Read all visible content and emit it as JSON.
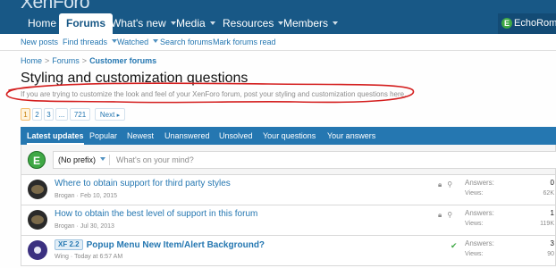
{
  "header": {
    "logo_text": "XenForo"
  },
  "nav": {
    "tabs": [
      {
        "label": "Home",
        "has_menu": false
      },
      {
        "label": "Forums",
        "has_menu": false,
        "active": true
      },
      {
        "label": "What's new",
        "has_menu": true
      },
      {
        "label": "Media",
        "has_menu": true
      },
      {
        "label": "Resources",
        "has_menu": true
      },
      {
        "label": "Members",
        "has_menu": true
      }
    ],
    "user": {
      "avatar_letter": "E",
      "name": "EchoRomeo"
    }
  },
  "subnav": {
    "items": [
      "New posts",
      "Find threads",
      "Watched",
      "Search forums",
      "Mark forums read"
    ]
  },
  "breadcrumb": {
    "items": [
      "Home",
      "Forums",
      "Customer forums"
    ],
    "separator": ">"
  },
  "page": {
    "title": "Styling and customization questions",
    "description": "If you are trying to customize the look and feel of your XenForo forum, post your styling and customization questions here."
  },
  "pagination": {
    "pages": [
      "1",
      "2",
      "3",
      "...",
      "721"
    ],
    "current": "1",
    "next_label": "Next"
  },
  "filter_tabs": [
    "Latest updates",
    "Popular",
    "Newest",
    "Unanswered",
    "Unsolved",
    "Your questions",
    "Your answers"
  ],
  "quick_thread": {
    "avatar_letter": "E",
    "prefix_label": "(No prefix)",
    "placeholder": "What's on your mind?"
  },
  "threads": [
    {
      "title": "Where to obtain support for third party styles",
      "prefix": "",
      "author": "Brogan",
      "date": "Feb 10, 2015",
      "icons": [
        "lock-icon",
        "pin-icon"
      ],
      "answers_label": "Answers:",
      "answers": "0",
      "views_label": "Views:",
      "views": "62K"
    },
    {
      "title": "How to obtain the best level of support in this forum",
      "prefix": "",
      "author": "Brogan",
      "date": "Jul 30, 2013",
      "icons": [
        "lock-icon",
        "pin-icon"
      ],
      "answers_label": "Answers:",
      "answers": "1",
      "views_label": "Views:",
      "views": "119K"
    },
    {
      "title": "Popup Menu New Item/Alert Background?",
      "prefix": "XF 2.2",
      "author": "Wing",
      "date": "Today at 6:57 AM",
      "icons": [
        "solved-icon"
      ],
      "answers_label": "Answers:",
      "answers": "3",
      "views_label": "Views:",
      "views": "90"
    }
  ],
  "colors": {
    "header_bg": "#185886",
    "accent": "#2577b1",
    "pager_current_bg": "#fef3dd",
    "solved": "#3fa845",
    "annotation_scribble": "#d41f1f"
  },
  "annotation": "red hand-drawn ellipse around forum description"
}
